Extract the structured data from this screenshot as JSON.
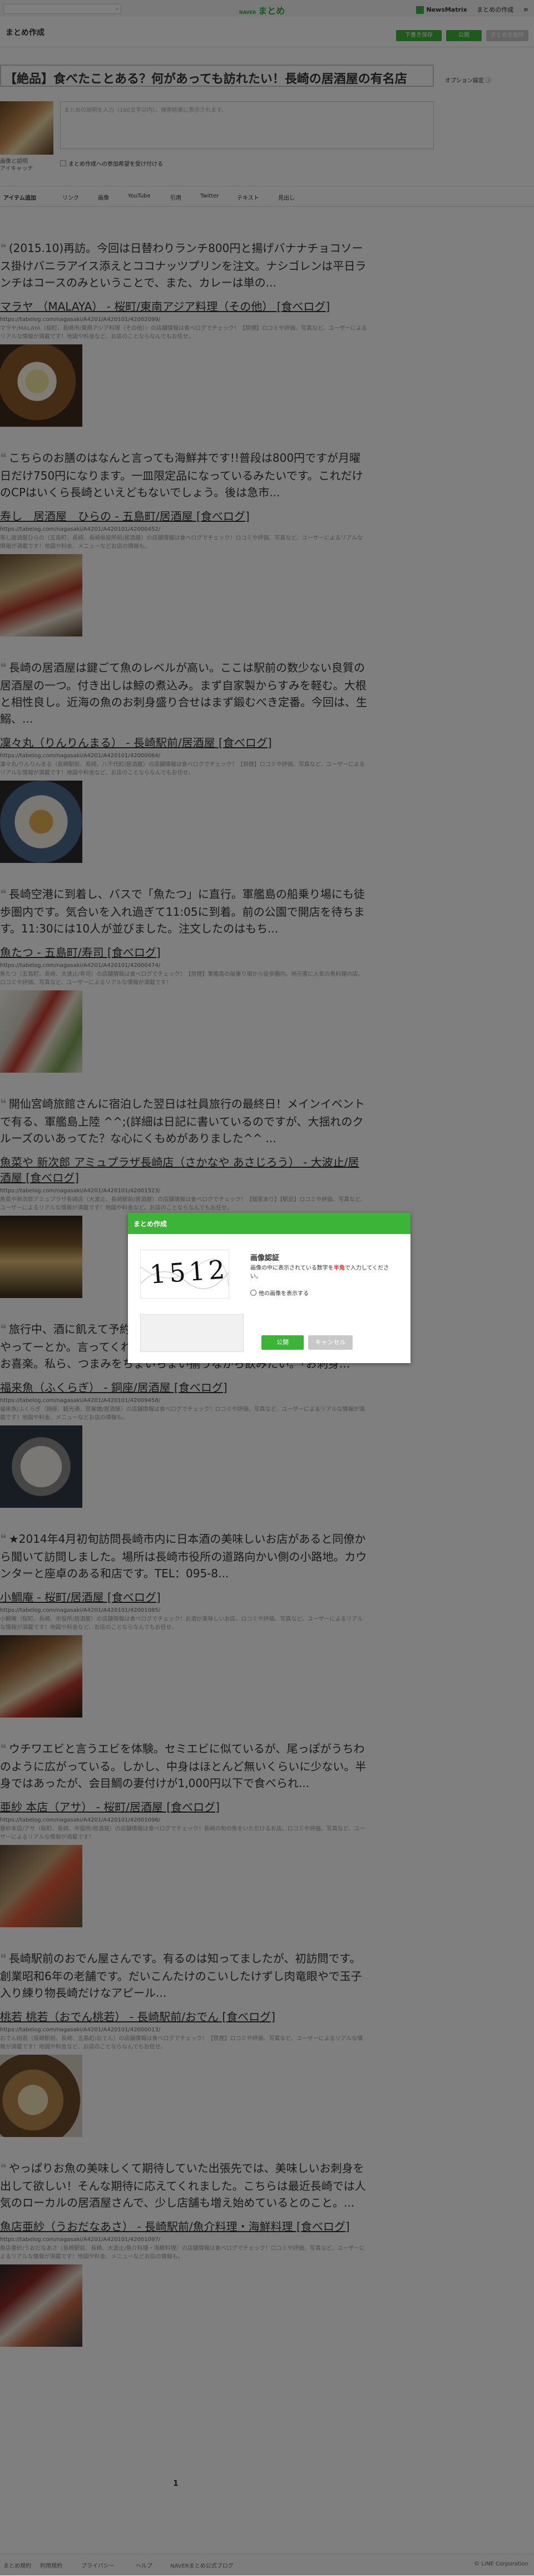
{
  "header": {
    "search_icon": "⌕",
    "brand_small": "NAVER",
    "brand": "まとめ",
    "nh": "NewsMatrix",
    "matome": "まとめの作成",
    "menu": "≡"
  },
  "subbar": {
    "title": "まとめ作成",
    "draft_btn": "下書き保存",
    "publish_btn": "公開",
    "delete_btn": "まとめを削除"
  },
  "edit": {
    "title": "【絶品】食べたことある？何があっても訪れたい！長崎の居酒屋の有名店",
    "optional": "オプション設定 ⓘ",
    "thumb_caption_1": "画像と説明",
    "thumb_caption_2": "アイキャッチ",
    "desc_placeholder": "まとめの説明を入力（160文字以内）。検索結果に表示されます。",
    "check_label": "まとめ作成への参加希望を受け付ける"
  },
  "toolbar": {
    "items": [
      "アイテム追加",
      "リンク",
      "画像",
      "YouTube",
      "引用",
      "Twitter",
      "テキスト",
      "見出し"
    ]
  },
  "entries": [
    {
      "text": "(2015.10)再訪。今回は日替わりランチ800円と揚げバナナチョコソース掛けバニラアイス添えとココナッツプリンを注文。ナシゴレンは平日ランチはコースのみということで、また、カレーは単の...",
      "link": "マラヤ （MALAYA） - 桜町/東南アジア料理（その他） [食べログ]",
      "url": "https://tabelog.com/nagasaki/A4201/A420101/42002099/",
      "desc": "マラヤ/MALAYA（桜町、長崎市/東南アジア料理（その他））の店舗情報は食べログでチェック！【禁煙】ロコミや評価、写真など、ユーザーによるリアルな情報が満載です！地図や料金など、お店のことならなんでもお任せ。"
    },
    {
      "text": "こちらのお膳のはなんと言っても海鮮丼です!!普段は800円ですが月曜日だけ750円になります。一皿限定品になっているみたいです。これだけのCPはいくら長崎といえどもないでしょう。後は急市...",
      "link": "寿し　居酒屋　ひらの - 五島町/居酒屋 [食べログ]",
      "url": "https://tabelog.com/nagasaki/A4201/A420101/42000452/",
      "desc": "寿し居酒屋ひらの（五島町、長崎、長崎県役所前/居酒屋）の店舗情報は食べログでチェック！ロコミや評価、写真など、ユーザーによるリアルな情報が満載です！地図や料金、メニューなどお店の情報も。"
    },
    {
      "text": "長崎の居酒屋は鍵ごて魚のレベルが高い。ここは駅前の数少ない良質の居酒屋の一つ。付き出しは鯨の煮込み。まず自家製からすみを軽む。大根と相性良し。近海の魚のお刺身盛り合せはまず鍛むべき定番。今回は、生鰯、...",
      "link": "凜々丸（りんりんまる） - 長崎駅前/居酒屋 [食べログ]",
      "url": "https://tabelog.com/nagasaki/A4201/A420101/42000064/",
      "desc": "凜々丸/りんりんまる（長崎駅前、長崎、八千代町/居酒屋）の店舗情報は食べログでチェック！【禁煙】ロコミや評価、写真など、ユーザーによるリアルな情報が満載です！地図や料金など、お店のことならなんでもお任せ。"
    },
    {
      "text": "長崎空港に到着し、バスで「魚たつ」に直行。軍艦島の船乗り場にも徒歩圏内です。気合いを入れ過ぎて11:05に到着。前の公園で開店を待ちます。11:30には10人が並びました。注文したのはもち...",
      "link": "魚たつ - 五島町/寿司 [食べログ]",
      "url": "https://tabelog.com/nagasaki/A4201/A420101/42000474/",
      "desc": "魚たつ（五島町、長崎、大波止/寿司）の店舗情報は食べログでチェック！【禁煙】軍艦島の船乗り場から徒歩圏内。地元客に人気の魚料理の店。ロコミや評価、写真など、ユーザーによるリアルな情報が満載です！"
    },
    {
      "text": "開仙宮崎旅館さんに宿泊した翌日は社員旅行の最終日！メインイベントで有る、軍艦島上陸 ^^;(詳細は日記に書いているのですが、大揺れのクルーズのいあってた？な心にくもめがありました^^ ...",
      "link": "魚菜や 新次郎 アミュプラザ長崎店（さかなや あさじろう） - 大波止/居酒屋 [食べログ]",
      "url": "https://tabelog.com/nagasaki/A4201/A420101/42001523/",
      "desc": "魚菜や新次郎アミュプラザ長崎店（大波止、長崎駅前/居酒屋）の店舗情報は食べログでチェック！【個室あり】【駅近】ロコミや評価、写真など、ユーザーによるリアルな情報が満載です！地図や料金など、お店のことならなんでもお任せ。"
    },
    {
      "text": "旅行中、酒に飢えて予約もしないで訪問。小さな店だから、平日はいてやってーとか。言ってくれて、居酒屋のような感じ。気配りが行き届いてお喜楽。私ら、つまみをちょいちょい揃うながら飲みたい。「お刺身...",
      "link": "福来魚（ふくらぎ） - 銅座/居酒屋 [食べログ]",
      "url": "https://tabelog.com/nagasaki/A4201/A420101/42009458/",
      "desc": "福来魚/ふくらぎ（銅座、観光通、思案橋/居酒屋）の店舗情報は食べログでチェック！ロコミや評価、写真など、ユーザーによるリアルな情報が満載です！地図や料金、メニューなどお店の情報も。"
    },
    {
      "text": "★2014年4月初旬訪問長崎市内に日本酒の美味しいお店があると同僚から聞いて訪問しました。場所は長崎市役所の道路向かい側の小路地。カウンターと座卓のある和店です。TEL：095-8...",
      "link": "小鯛庵 - 桜町/居酒屋 [食べログ]",
      "url": "https://tabelog.com/nagasaki/A4201/A420101/42001085/",
      "desc": "小鯛庵（桜町、長崎、市役所/居酒屋）の店舗情報は食べログでチェック！お酒が美味しいお店。ロコミや評価、写真など、ユーザーによるリアルな情報が満載です！地図や料金など、お店のことならなんでもお任せ。"
    },
    {
      "text": "ウチワエビと言うエビを体験。セミエビに似ているが、尾っぽがうちわのように広がっている。しかし、中身はほとんど無いくらいに少ない。半身ではあったが、会目鯛の妻付けが1,000円以下で食べられ...",
      "link": "亜紗 本店（アサ） - 桜町/居酒屋 [食べログ]",
      "url": "https://tabelog.com/nagasaki/A4201/A420101/42001096/",
      "desc": "亜紗本店/アサ（桜町、長崎、市役所/居酒屋）の店舗情報は食べログでチェック！長崎の旬の魚をいただけるお店。ロコミや評価、写真など、ユーザーによるリアルな情報が満載です！"
    },
    {
      "text": "長崎駅前のおでん屋さんです。有るのは知ってましたが、初訪問です。創業昭和6年の老舗です。だいこんたけのこいしたけずし肉竜眼やで玉子入り練り物長崎だけなアピール...",
      "link": "桃若 桃若（おでん桃若） - 長崎駅前/おでん [食べログ]",
      "url": "https://tabelog.com/nagasaki/A4201/A420101/42000013/",
      "desc": "おでん桃若（長崎駅前、長崎、五島町/おでん）の店舗情報は食べログでチェック！【禁煙】ロコミや評価、写真など、ユーザーによるリアルな情報が満載です！地図や料金など、お店のことならなんでもお任せ。"
    },
    {
      "text": "やっぱりお魚の美味しくて期待していた出張先では、美味しいお刺身を出して欲しい！そんな期待に応えてくれました。こちらは最近長崎では人気のローカルの居酒屋さんで、少し店舗も増え始めているとのこと。...",
      "link": "魚店亜紗（うおだなあさ） - 長崎駅前/魚介料理・海鮮料理 [食べログ]",
      "url": "https://tabelog.com/nagasaki/A4201/A420101/42001097/",
      "desc": "魚店亜紗/うおだなあさ（長崎駅前、長崎、大波止/魚介料理・海鮮料理）の店舗情報は食べログでチェック！ロコミや評価、写真など、ユーザーによるリアルな情報が満載です！地図や料金、メニューなどお店の情報も。"
    }
  ],
  "pager": "1",
  "footer": {
    "links": [
      "まとめ規約",
      "利用規約",
      "プライバシー",
      "ヘルプ",
      "NAVERまとめ公式ブログ"
    ],
    "copyright": "© LINE Corporation"
  },
  "modal": {
    "header": "まとめ作成",
    "captcha_text": "1512",
    "title": "画像認証",
    "desc_1": "画像の中に表示されている数字を",
    "desc_red": "半角",
    "desc_2": "で入力してください。",
    "other_image": "他の画像を表示する",
    "submit": "公開",
    "cancel": "キャンセル"
  },
  "colors": {
    "brand_green": "#2cb43b",
    "modal_header": "#3cb437",
    "accent_red": "#e53333"
  }
}
